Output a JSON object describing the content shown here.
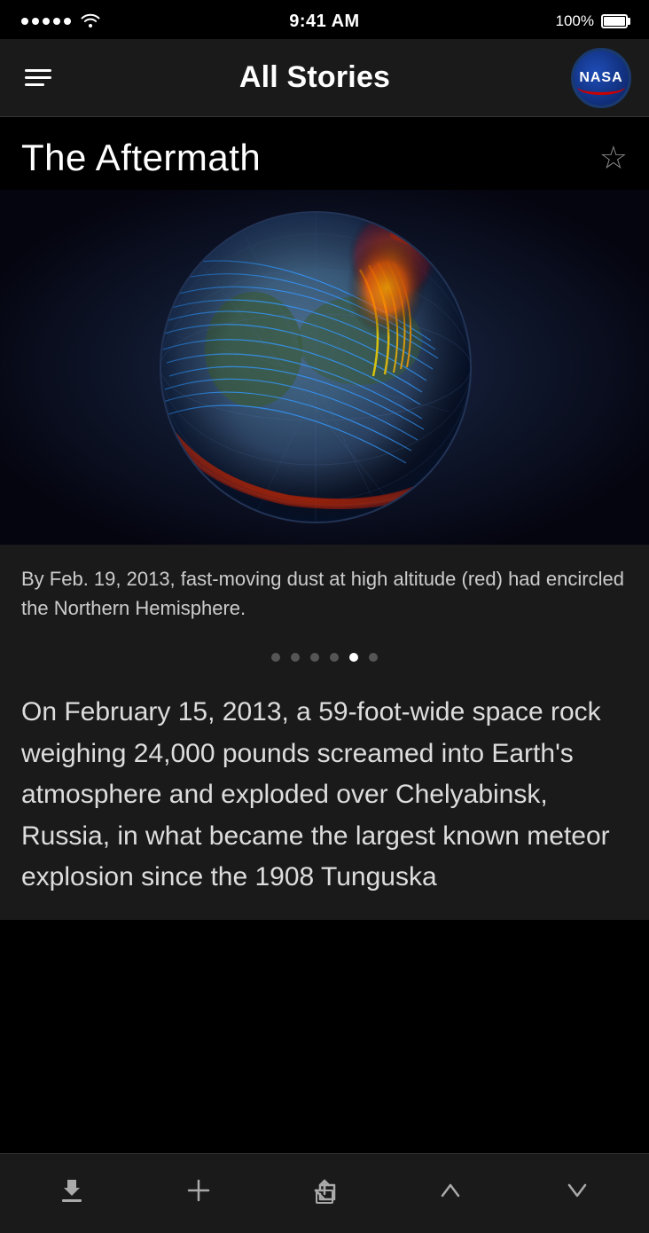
{
  "status": {
    "time": "9:41 AM",
    "battery": "100%",
    "signal_dots": 5
  },
  "nav": {
    "title": "All Stories",
    "menu_label": "Menu",
    "nasa_label": "NASA Logo"
  },
  "story": {
    "title": "The Aftermath",
    "star_label": "Bookmark",
    "caption": "By Feb. 19, 2013, fast-moving dust at high altitude (red) had encircled the Northern Hemisphere.",
    "body": "On February 15, 2013, a 59-foot-wide space rock weighing 24,000 pounds screamed into Earth's atmosphere and exploded over Chelyabinsk, Russia, in what became the largest known meteor explosion since the 1908 Tunguska",
    "dots": [
      {
        "active": false
      },
      {
        "active": false
      },
      {
        "active": false
      },
      {
        "active": false
      },
      {
        "active": true
      },
      {
        "active": false
      }
    ]
  },
  "toolbar": {
    "download_label": "Download",
    "add_label": "Add",
    "share_label": "Share",
    "prev_label": "Previous",
    "next_label": "Next"
  },
  "colors": {
    "background": "#000000",
    "nav_bg": "#1a1a1a",
    "text_primary": "#ffffff",
    "text_secondary": "#cccccc",
    "accent": "#888888"
  }
}
